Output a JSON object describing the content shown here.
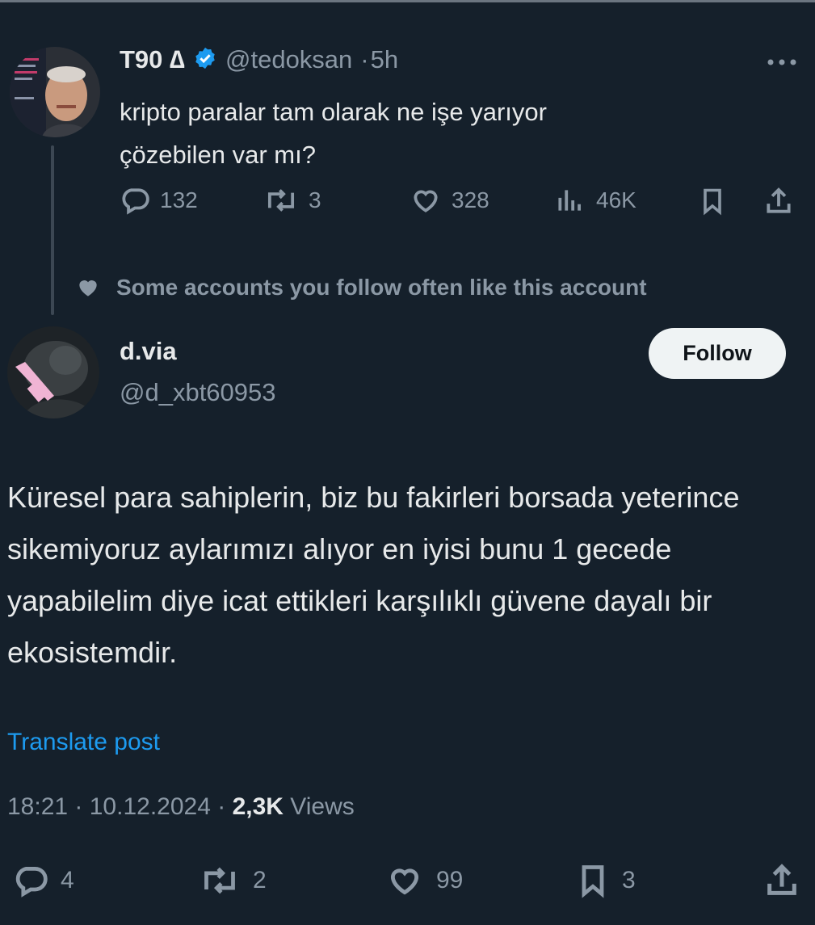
{
  "tweet1": {
    "author_name": "T90 ∆",
    "handle": "@tedoksan",
    "time": "5h",
    "text_line1": "kripto paralar tam olarak ne işe yarıyor",
    "text_line2": "çözebilen var mı?",
    "replies": "132",
    "reposts": "3",
    "likes": "328",
    "views": "46K"
  },
  "social_context": "Some accounts you follow often like this account",
  "tweet2": {
    "author_name": "d.via",
    "handle": "@d_xbt60953",
    "follow_label": "Follow",
    "text": "Küresel para sahiplerin, biz bu fakirleri borsada yeterince sikemiyoruz aylarımızı alıyor en iyisi bunu 1 gecede yapabilelim diye icat ettikleri karşılıklı güvene dayalı bir ekosistemdir.",
    "translate_label": "Translate post",
    "time": "18:21",
    "date": "10.12.2024",
    "views_count": "2,3K",
    "views_label": "Views",
    "replies": "4",
    "reposts": "2",
    "likes": "99",
    "bookmarks": "3"
  },
  "icons": [
    "more-icon",
    "verified-icon",
    "reply-icon",
    "repost-icon",
    "like-icon",
    "views-icon",
    "bookmark-icon",
    "share-icon",
    "heart-icon"
  ],
  "colors": {
    "background": "#15202b",
    "text": "#e7e9ea",
    "muted": "#8b98a5",
    "link": "#1d9bf0",
    "verified": "#1d9bf0",
    "follow_bg": "#eff3f4"
  }
}
